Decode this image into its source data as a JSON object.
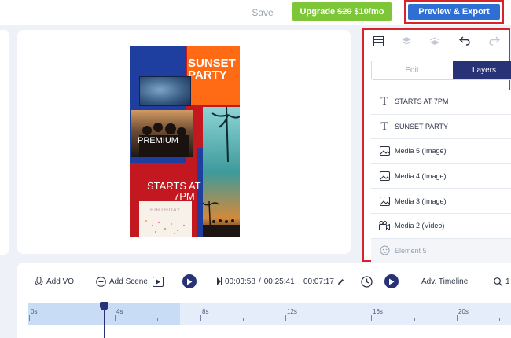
{
  "topbar": {
    "save_label": "Save",
    "upgrade_label": "Upgrade",
    "upgrade_old_price": "$20",
    "upgrade_new_price": "$10/mo",
    "preview_label": "Preview & Export"
  },
  "poster": {
    "title_line1": "SUNSET",
    "title_line2": "PARTY",
    "premium_label": "PREMIUM",
    "starts_line1": "STARTS AT",
    "starts_line2": "7PM",
    "card_text": "BIRTHDAY"
  },
  "panel": {
    "tools": [
      "grid-icon",
      "layer-down-icon",
      "layer-up-icon",
      "undo-icon",
      "redo-icon"
    ],
    "tab_edit": "Edit",
    "tab_layers": "Layers",
    "layers": [
      {
        "label": "STARTS AT 7PM",
        "icon": "text-icon"
      },
      {
        "label": "SUNSET PARTY",
        "icon": "text-icon"
      },
      {
        "label": "Media 5 (Image)",
        "icon": "image-icon"
      },
      {
        "label": "Media 4 (Image)",
        "icon": "image-icon"
      },
      {
        "label": "Media 3 (Image)",
        "icon": "image-icon"
      },
      {
        "label": "Media 2 (Video)",
        "icon": "video-icon"
      },
      {
        "label": "Element 5",
        "icon": "element-icon"
      }
    ]
  },
  "controls": {
    "add_vo": "Add VO",
    "add_scene": "Add Scene",
    "time_current": "00:03:58",
    "time_separator": "/",
    "time_total": "00:25:41",
    "duration": "00:07:17",
    "adv_timeline": "Adv. Timeline",
    "zoom_value": "1"
  },
  "timeline": {
    "ticks": [
      "0s",
      "4s",
      "8s",
      "12s",
      "16s",
      "20s"
    ]
  },
  "colors": {
    "accent": "#273277",
    "upgrade": "#7cc638",
    "preview": "#2f6fd4",
    "highlight": "#d8232a"
  }
}
